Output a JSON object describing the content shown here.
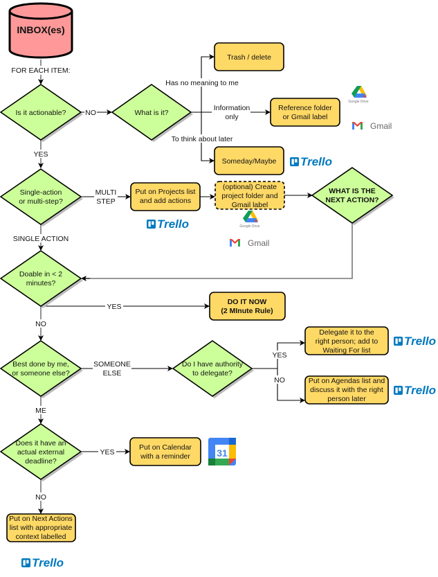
{
  "colors": {
    "inbox": "#ff9999",
    "decision": "#ccff99",
    "action": "#ffd966",
    "trello": "#0079bf"
  },
  "inbox": {
    "label": "INBOX(es)"
  },
  "edges": {
    "for_each": "FOR EACH ITEM:",
    "no1": "NO",
    "yes1": "YES",
    "no_meaning": "Has no meaning to me",
    "info_only": [
      "Information",
      "only"
    ],
    "think_later": "To think about later",
    "multi_step": [
      "MULTI",
      "STEP"
    ],
    "single_action": "SINGLE ACTION",
    "yes2": "YES",
    "no2": "NO",
    "someone_else": [
      "SOMEONE",
      "ELSE"
    ],
    "yes3": "YES",
    "no3": "NO",
    "me": "ME",
    "yes4": "YES",
    "no4": "NO"
  },
  "decisions": {
    "actionable": [
      "Is it actionable?"
    ],
    "what_is_it": [
      "What is it?"
    ],
    "single_multi": [
      "Single-action",
      "or multi-step?"
    ],
    "next_action": [
      "WHAT IS THE",
      "NEXT ACTION?"
    ],
    "doable": [
      "Doable in < 2",
      "minutes?"
    ],
    "best_done": [
      "Best done by me,",
      "or someone else?"
    ],
    "authority": [
      "Do I have authority",
      "to delegate?"
    ],
    "deadline": [
      "Does it have an",
      "actual external",
      "deadline?"
    ]
  },
  "actions": {
    "trash": [
      "Trash / delete"
    ],
    "reference": [
      "Reference folder",
      "or Gmail label"
    ],
    "someday": [
      "Someday/Maybe"
    ],
    "projects": [
      "Put on Projects list",
      "and add actions"
    ],
    "create_folder": [
      "(optional) Create",
      "project folder and",
      "Gmail label"
    ],
    "do_it_now": [
      "DO IT NOW",
      "(2 MInute Rule)"
    ],
    "delegate": [
      "Delegate it to the",
      "right person; add to",
      "Waiting For list"
    ],
    "agendas": [
      "Put on Agendas list and",
      "discuss it with the right",
      "person later"
    ],
    "calendar": [
      "Put on Calendar",
      "with a reminder"
    ],
    "next_actions": [
      "Put on Next Actions",
      "list with appropriate",
      "context labelled"
    ]
  },
  "logos": {
    "trello": "Trello",
    "gmail": "Gmail",
    "google_drive": "Google Drive",
    "calendar_day": "31"
  }
}
